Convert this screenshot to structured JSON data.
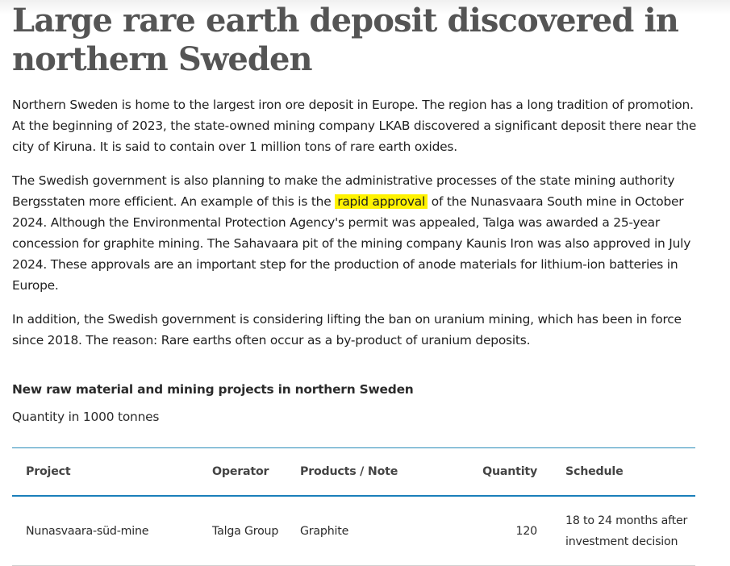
{
  "article": {
    "headline": "Large rare earth deposit discovered in northern Sweden",
    "p1": "Northern Sweden is home to the largest iron ore deposit in Europe. The region has a long tradition of promotion. At the beginning of 2023, the state-owned mining company LKAB discovered a significant deposit there near the city of Kiruna. It is said to contain over 1 million tons of rare earth oxides.",
    "p2_before": "The Swedish government is also planning to make the administrative processes of the state mining authority Bergsstaten more efficient. An example of this is the",
    "p2_highlight": "rapid approval",
    "p2_after": "of the Nunasvaara South mine in October 2024. Although the Environmental Protection Agency's permit was appealed, Talga was awarded a 25-year concession for graphite mining. The Sahavaara pit of the mining company Kaunis Iron was also approved in July 2024. These approvals are an important step for the production of anode materials for lithium-ion batteries in Europe.",
    "p3": "In addition, the Swedish government is considering lifting the ban on uranium mining, which has been in force since 2018. The reason: Rare earths often occur as a by-product of uranium deposits."
  },
  "colors": {
    "highlight": "#fff200",
    "table_rule": "#1a7fba",
    "headline": "#555555"
  },
  "table": {
    "title": "New raw material and mining projects in northern Sweden",
    "subtitle": "Quantity in 1000 tonnes",
    "headers": {
      "project": "Project",
      "operator": "Operator",
      "products": "Products / Note",
      "quantity": "Quantity",
      "schedule": "Schedule"
    },
    "rows": [
      {
        "project": "Nunasvaara-süd-mine",
        "operator": "Talga Group",
        "products": "Graphite",
        "quantity": "120",
        "schedule": "18 to 24 months after investment decision"
      }
    ]
  }
}
